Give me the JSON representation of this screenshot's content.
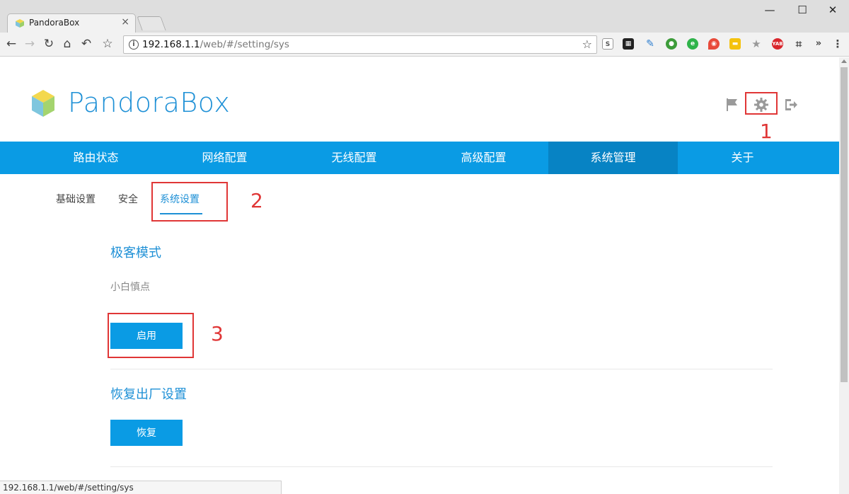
{
  "browser": {
    "tab_title": "PandoraBox",
    "tab_close": "×",
    "window_controls": {
      "minimize": "—",
      "maximize": "☐",
      "close": "✕"
    },
    "url_host": "192.168.1.1",
    "url_path": "/web/#/setting/sys",
    "status_url": "192.168.1.1/web/#/setting/sys"
  },
  "header": {
    "logo_text": "PandoraBox",
    "icons": [
      "flag-icon",
      "gear-icon",
      "logout-icon"
    ]
  },
  "main_nav": {
    "items": [
      {
        "label": "路由状态",
        "active": false
      },
      {
        "label": "网络配置",
        "active": false
      },
      {
        "label": "无线配置",
        "active": false
      },
      {
        "label": "高级配置",
        "active": false
      },
      {
        "label": "系统管理",
        "active": true
      },
      {
        "label": "关于",
        "active": false
      }
    ]
  },
  "sub_nav": {
    "items": [
      {
        "label": "基础设置",
        "active": false
      },
      {
        "label": "安全",
        "active": false
      },
      {
        "label": "系统设置",
        "active": true
      }
    ]
  },
  "geek_mode": {
    "title": "极客模式",
    "hint": "小白慎点",
    "button_label": "启用"
  },
  "factory_reset": {
    "title": "恢复出厂设置",
    "button_label": "恢复"
  },
  "annotations": {
    "step1": "1",
    "step2": "2",
    "step3": "3"
  },
  "colors": {
    "accent": "#0a9be4",
    "accent_dark": "#0783c4",
    "annotation": "#e03636",
    "link": "#1e90d6"
  }
}
